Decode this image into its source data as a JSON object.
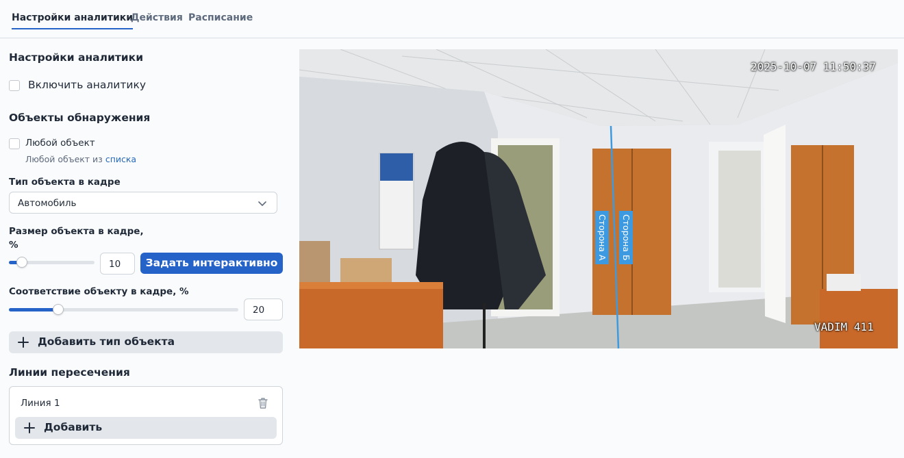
{
  "tabs": [
    {
      "label": "Настройки аналитики",
      "active": true
    },
    {
      "label": "Действия",
      "active": false
    },
    {
      "label": "Расписание",
      "active": false
    }
  ],
  "analytics": {
    "title": "Настройки аналитики",
    "enable_label": "Включить аналитику",
    "enabled": false
  },
  "objects": {
    "title": "Объекты обнаружения",
    "any_label": "Любой объект",
    "any_checked": false,
    "any_hint_prefix": "Любой объект из",
    "any_hint_link": "списка"
  },
  "object_type": {
    "label": "Тип объекта в кадре",
    "value": "Автомобиль"
  },
  "size": {
    "label_line1": "Размер объекта в кадре,",
    "label_line2": "%",
    "value": "10",
    "slider_fraction": 0.1,
    "interactive_button": "Задать интерактивно"
  },
  "match": {
    "label": "Соответствие объекту в кадре, %",
    "value": "20",
    "slider_fraction": 0.2
  },
  "add_type_button": "Добавить тип объекта",
  "crossing": {
    "title": "Линии пересечения",
    "lines": [
      {
        "name": "Линия 1"
      }
    ],
    "add_button": "Добавить"
  },
  "camera": {
    "timestamp": "2025-10-07 11:50:37",
    "camera_name": "VADIM 411",
    "side_a": "Сторона А",
    "side_b": "Сторона Б"
  },
  "colors": {
    "accent": "#2563c9",
    "line": "#3d9ae0"
  },
  "icons": [
    "plus-icon",
    "chevron-down-icon",
    "trash-icon"
  ]
}
